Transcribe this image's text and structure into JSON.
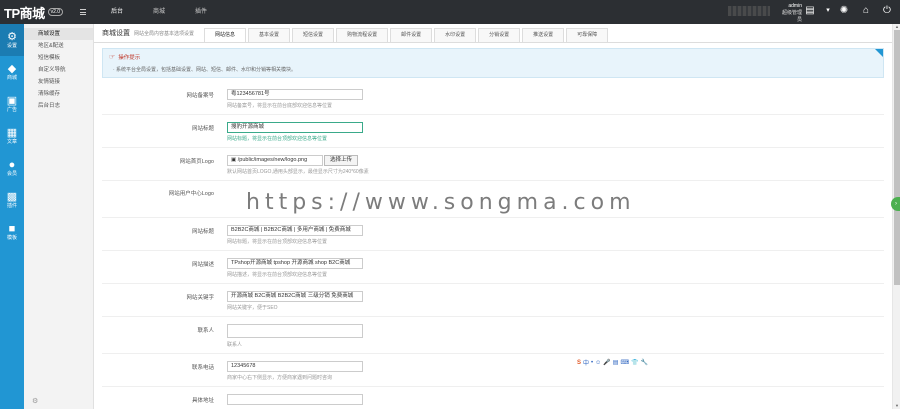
{
  "app": {
    "logo": "TP商城",
    "version": "v2.0"
  },
  "topnav": [
    {
      "label": "后台",
      "active": true
    },
    {
      "label": "商城",
      "active": false
    },
    {
      "label": "插件",
      "active": false
    }
  ],
  "user": {
    "name": "admin",
    "role": "超级管理员"
  },
  "icons": {
    "topbar": [
      "cart-icon",
      "id-card-icon",
      "network-icon",
      "home-icon",
      "power-icon"
    ],
    "rail": [
      "gear-icon",
      "diamond-icon",
      "monitor-icon",
      "document-icon",
      "users-icon",
      "grid-icon",
      "folder-icon"
    ]
  },
  "rail": [
    {
      "label": "设置",
      "active": true
    },
    {
      "label": "商城",
      "active": false
    },
    {
      "label": "广告",
      "active": false
    },
    {
      "label": "文章",
      "active": false
    },
    {
      "label": "会员",
      "active": false
    },
    {
      "label": "插件",
      "active": false
    },
    {
      "label": "模板",
      "active": false
    }
  ],
  "submenu": [
    {
      "label": "商城设置",
      "active": true
    },
    {
      "label": "地区&配送",
      "active": false
    },
    {
      "label": "短信模板",
      "active": false
    },
    {
      "label": "自定义导航",
      "active": false
    },
    {
      "label": "友情链接",
      "active": false
    },
    {
      "label": "清除缓存",
      "active": false
    },
    {
      "label": "后台日志",
      "active": false
    }
  ],
  "page": {
    "title": "商城设置",
    "subtitle": "网站全局内容基本选项设置",
    "tabs": [
      {
        "label": "网站信息",
        "active": true
      },
      {
        "label": "基本设置",
        "active": false
      },
      {
        "label": "短信设置",
        "active": false
      },
      {
        "label": "购物流程设置",
        "active": false
      },
      {
        "label": "邮件设置",
        "active": false
      },
      {
        "label": "水印设置",
        "active": false
      },
      {
        "label": "分销设置",
        "active": false
      },
      {
        "label": "推送设置",
        "active": false
      },
      {
        "label": "可靠保障",
        "active": false
      }
    ]
  },
  "tips": {
    "title": "操作提示",
    "text": "· 系统平台全局设置，包括基础设置、网站、短信、邮件、水印和分销等相关模块。"
  },
  "form": [
    {
      "label": "网站备案号",
      "value": "粤123456781号",
      "hint": "网站备案号，将显示在前台底部欢迎信息等位置"
    },
    {
      "label": "网站标题",
      "value": "搜豹开源商城",
      "hint": "网站标题，将显示在前台顶部欢迎信息等位置",
      "focused": true
    },
    {
      "label": "网站首页Logo",
      "value": "/public/images/new/logo.png",
      "button": "选择上传",
      "hint": "默认网站首页LOGO,通用头部显示，最佳显示尺寸为240*60像素"
    },
    {
      "label": "网站用户中心Logo",
      "value": "",
      "hint": ""
    },
    {
      "label": "网站标题",
      "value": "B2B2C商城 | B2B2C商城 | 多用户商城 | 免费商城",
      "hint": "网站标题，将显示在前台顶部欢迎信息等位置"
    },
    {
      "label": "网站描述",
      "value": "TPshop开源商城 tpshop 开源商城 shop B2C商城",
      "hint": "网站描述，将显示在前台顶部欢迎信息等位置"
    },
    {
      "label": "网站关键字",
      "value": "开源商城 B2C商城 B2B2C商城 三级分销 免费商城",
      "hint": "网站关键字，便于SEO"
    },
    {
      "label": "联系人",
      "value": "",
      "hint": "联系人"
    },
    {
      "label": "联系电话",
      "value": "12345678",
      "hint": "商家中心右下侧显示，方便商家遇到问题时咨询"
    },
    {
      "label": "具体地址",
      "value": "",
      "hint": ""
    }
  ],
  "watermark": "https://www.songma.com",
  "ime": {
    "logo": "S",
    "items": [
      "中",
      "•",
      "☺",
      "🎤",
      "▤",
      "⌨",
      "👕",
      "🔧"
    ]
  }
}
